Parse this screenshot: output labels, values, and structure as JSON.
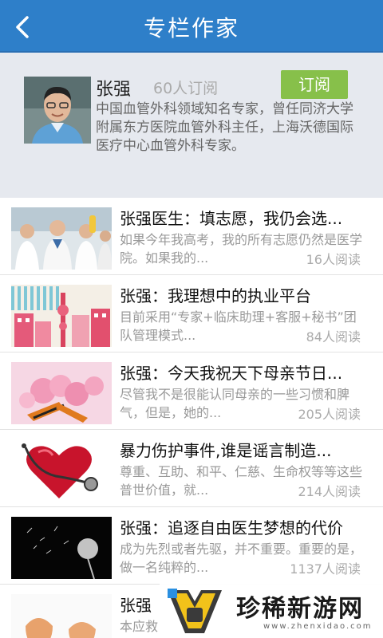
{
  "header": {
    "title": "专栏作家",
    "back_icon": "chevron-left-icon"
  },
  "author": {
    "name": "张强",
    "subscribers": "60人订阅",
    "subscribe_label": "订阅",
    "description": "中国血管外科领域知名专家，曾任同济大学附属东方医院血管外科主任，上海沃德国际医疗中心血管外科专家。"
  },
  "articles": [
    {
      "title": "张强医生：填志愿，我仍会选...",
      "summary": "如果今年我高考，我的所有志愿仍然是医学院。如果我的...",
      "reads": "16人阅读",
      "thumb": "doctors-lab-image"
    },
    {
      "title": "张强：我理想中的执业平台",
      "summary": "目前采用“专家+临床助理+客服+秘书”团队管理模式...",
      "reads": "84人阅读",
      "thumb": "city-illustration-image"
    },
    {
      "title": "张强：今天我祝天下母亲节日...",
      "summary": "尽管我不是很能认同母亲的一些习惯和脾气，但是，她的...",
      "reads": "205人阅读",
      "thumb": "carnation-flowers-image"
    },
    {
      "title": "暴力伤护事件,谁是谣言制造...",
      "summary": "尊重、互助、和平、仁慈、生命权等等这些普世价值，就...",
      "reads": "214人阅读",
      "thumb": "heart-stethoscope-image"
    },
    {
      "title": "张强：追逐自由医生梦想的代价",
      "summary": "成为先烈或者先驱，并不重要。重要的是，做一名纯粹的...",
      "reads": "1137人阅读",
      "thumb": "dandelion-image"
    },
    {
      "title": "张强",
      "summary": "本应救",
      "reads": "",
      "thumb": "eggshell-image"
    }
  ],
  "watermark": {
    "text": "珍稀新游网",
    "url": "www.zhenxidao.com"
  },
  "colors": {
    "header": "#2e7fc9",
    "subscribe": "#87c04a",
    "panel": "#e6e9ef"
  }
}
